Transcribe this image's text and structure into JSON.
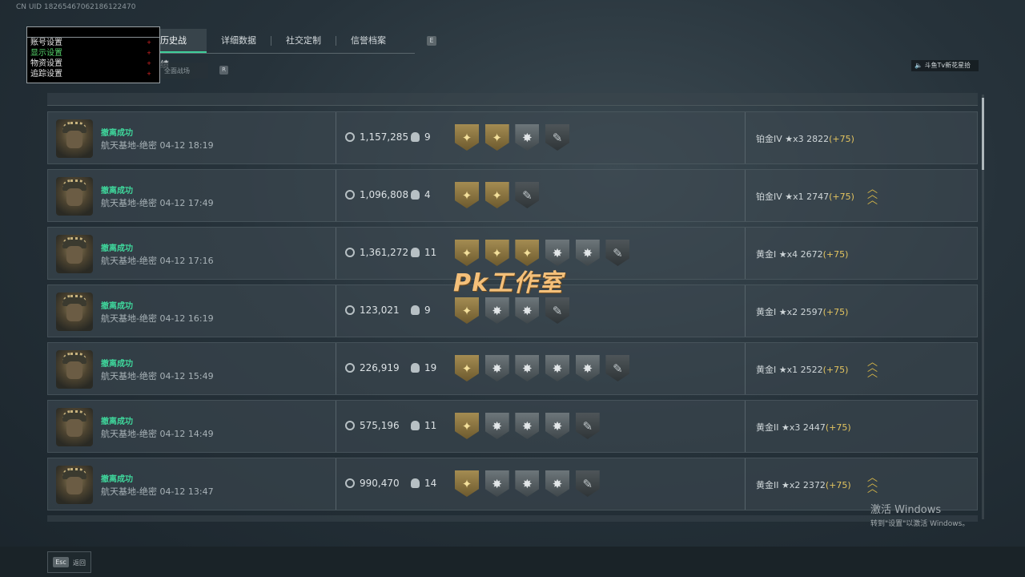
{
  "uid": "CN UID 18265467062186122470",
  "bg_title": "",
  "tabs": [
    {
      "label": "历史战绩",
      "active": true
    },
    {
      "label": "详细数据"
    },
    {
      "label": "社交定制"
    },
    {
      "label": "信誉档案"
    }
  ],
  "tab_key": "E",
  "subfilter": {
    "label": "全面战场",
    "key": "R"
  },
  "overlay_menu": {
    "items": [
      {
        "label": "账号设置",
        "color": "#e5e5e5"
      },
      {
        "label": "显示设置",
        "color": "#56d36b"
      },
      {
        "label": "物资设置",
        "color": "#e5e5e5"
      },
      {
        "label": "追踪设置",
        "color": "#e5e5e5"
      }
    ],
    "arrow": "+"
  },
  "streamer": "🔈 斗鱼Tv新花星拾",
  "rows": [
    {
      "status": "撤离成功",
      "detail": "航天基地-绝密 04-12 18:19",
      "money": "1,157,285",
      "kills": "9",
      "badges": [
        "gold",
        "gold",
        "grey",
        "dark"
      ],
      "rank": "铂金IV ★x3  2822",
      "plus": "(+75)",
      "chevron": false
    },
    {
      "status": "撤离成功",
      "detail": "航天基地-绝密 04-12 17:49",
      "money": "1,096,808",
      "kills": "4",
      "badges": [
        "gold",
        "gold",
        "dark"
      ],
      "rank": "铂金IV ★x1  2747",
      "plus": "(+75)",
      "chevron": true
    },
    {
      "status": "撤离成功",
      "detail": "航天基地-绝密 04-12 17:16",
      "money": "1,361,272",
      "kills": "11",
      "badges": [
        "gold",
        "gold",
        "gold",
        "grey",
        "grey",
        "dark"
      ],
      "rank": "黄金I ★x4  2672",
      "plus": "(+75)",
      "chevron": false
    },
    {
      "status": "撤离成功",
      "detail": "航天基地-绝密 04-12 16:19",
      "money": "123,021",
      "kills": "9",
      "badges": [
        "gold",
        "grey",
        "grey",
        "dark"
      ],
      "rank": "黄金I ★x2  2597",
      "plus": "(+75)",
      "chevron": false
    },
    {
      "status": "撤离成功",
      "detail": "航天基地-绝密 04-12 15:49",
      "money": "226,919",
      "kills": "19",
      "badges": [
        "gold",
        "grey",
        "grey",
        "grey",
        "grey",
        "dark"
      ],
      "rank": "黄金I ★x1  2522",
      "plus": "(+75)",
      "chevron": true
    },
    {
      "status": "撤离成功",
      "detail": "航天基地-绝密 04-12 14:49",
      "money": "575,196",
      "kills": "11",
      "badges": [
        "gold",
        "grey",
        "grey",
        "grey",
        "dark"
      ],
      "rank": "黄金II ★x3  2447",
      "plus": "(+75)",
      "chevron": false
    },
    {
      "status": "撤离成功",
      "detail": "航天基地-绝密 04-12 13:47",
      "money": "990,470",
      "kills": "14",
      "badges": [
        "gold",
        "grey",
        "grey",
        "grey",
        "dark"
      ],
      "rank": "黄金II ★x2  2372",
      "plus": "(+75)",
      "chevron": true
    }
  ],
  "watermark": "Pk工作室",
  "footer": {
    "esc_key": "Esc",
    "esc_label": "返回"
  },
  "activate_windows": {
    "line1": "激活 Windows",
    "line2": "转到\"设置\"以激活 Windows。"
  }
}
